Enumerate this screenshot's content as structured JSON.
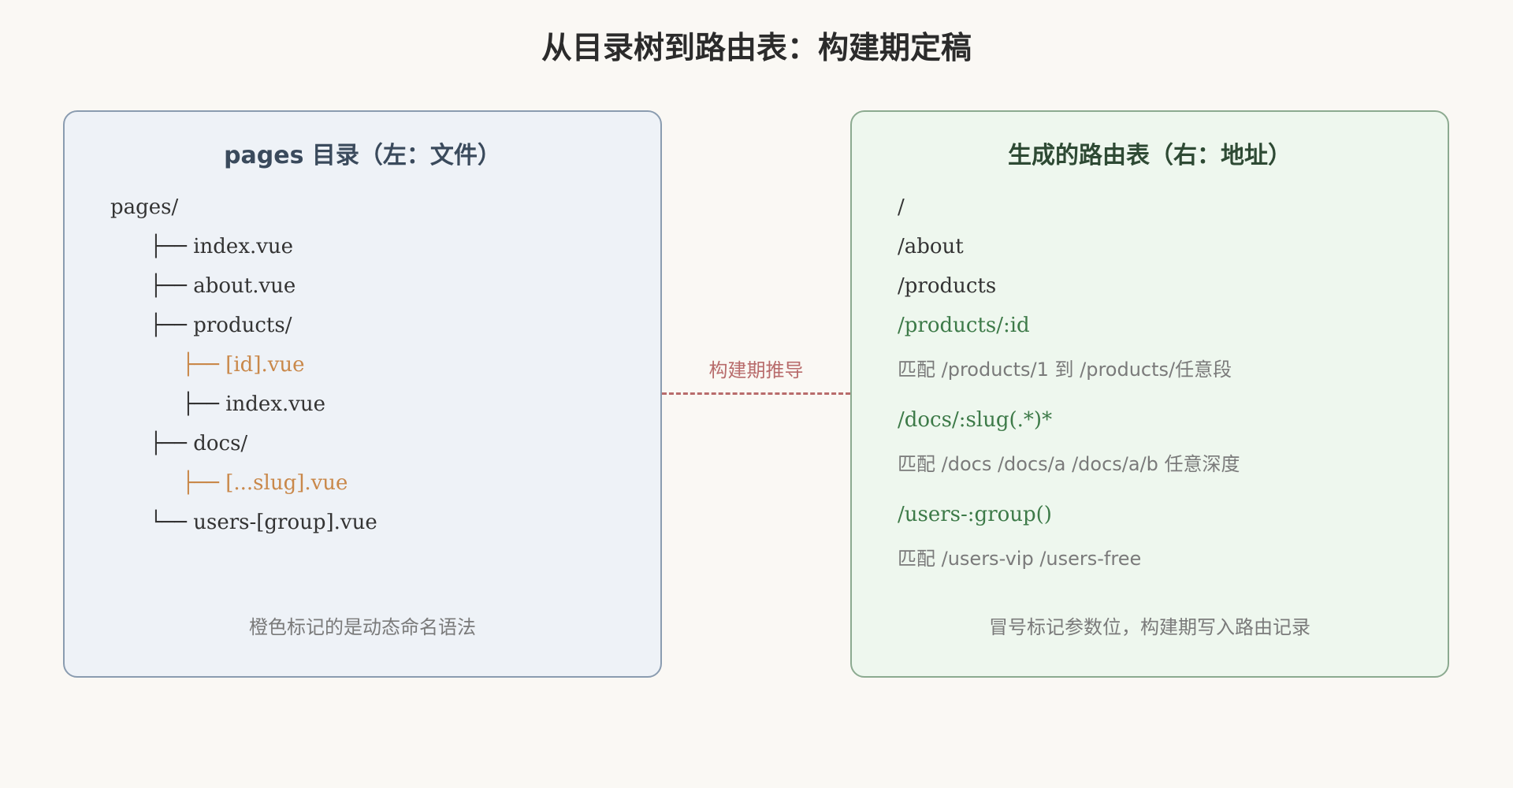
{
  "title": "从目录树到路由表：构建期定稿",
  "left_panel": {
    "title": "pages 目录（左：文件）",
    "tree": [
      "pages/",
      "├── index.vue",
      "├── about.vue",
      "├── products/",
      "├── [id].vue",
      "├── index.vue",
      "├── docs/",
      "├── [...slug].vue",
      "└── users-[group].vue"
    ],
    "footer": "橙色标记的是动态命名语法"
  },
  "connector": {
    "label": "构建期推导"
  },
  "right_panel": {
    "title": "生成的路由表（右：地址）",
    "routes": [
      "/",
      "/about",
      "/products",
      "/products/:id",
      "/docs/:slug(.*)*",
      "/users-:group()"
    ],
    "notes": [
      "匹配 /products/1 到 /products/任意段",
      "匹配 /docs /docs/a /docs/a/b 任意深度",
      "匹配 /users-vip /users-free"
    ],
    "footer": "冒号标记参数位，构建期写入路由记录"
  },
  "colors": {
    "dynamic_file": "#c9884a",
    "route_param": "#3d7a48",
    "connector": "#b86b6b",
    "left_panel_bg": "#eef2f7",
    "right_panel_bg": "#eef7ee"
  }
}
